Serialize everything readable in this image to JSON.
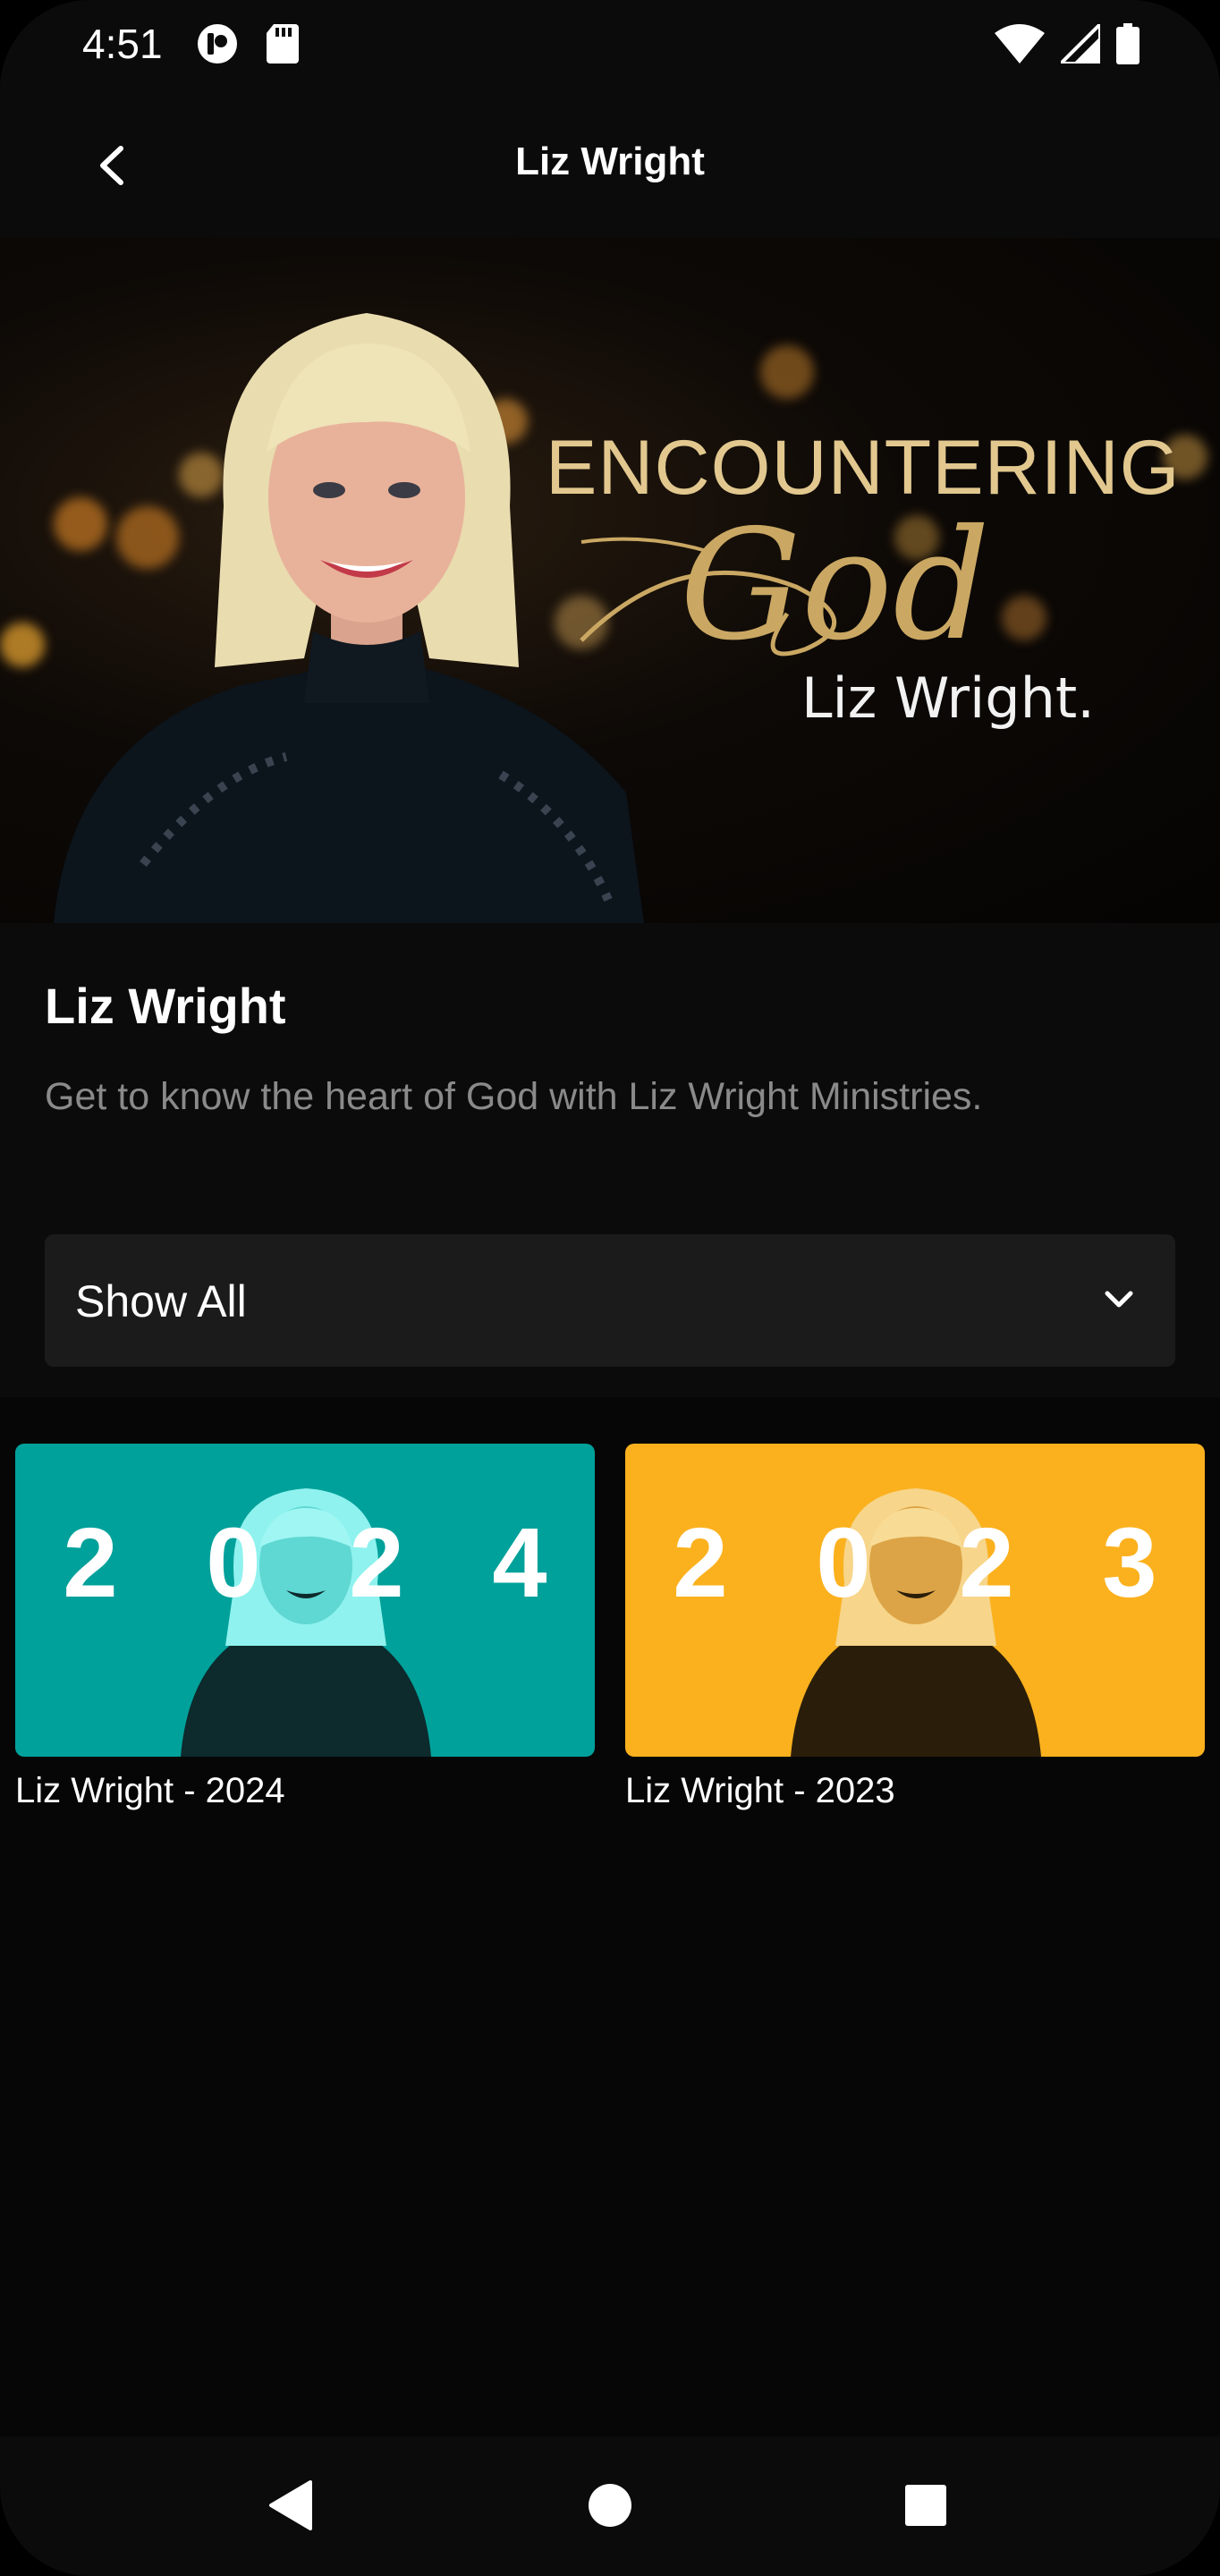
{
  "status_bar": {
    "time": "4:51",
    "left_icons": [
      "notification-app-icon",
      "sd-card-icon"
    ],
    "right_icons": [
      "wifi-icon",
      "signal-icon",
      "battery-icon"
    ]
  },
  "app_bar": {
    "title": "Liz Wright",
    "back_icon": "back-chevron-icon"
  },
  "hero": {
    "line1": "ENCOUNTERING",
    "line2": "God",
    "line3": "Liz Wright."
  },
  "info": {
    "title": "Liz Wright",
    "description": "Get to know the heart of God with Liz Wright Ministries."
  },
  "filter": {
    "selected": "Show All",
    "icon": "chevron-down-icon"
  },
  "cards": [
    {
      "label": "Liz Wright - 2024",
      "digits": [
        "2",
        "0",
        "2",
        "4"
      ],
      "color": "#00a19b"
    },
    {
      "label": "Liz Wright - 2023",
      "digits": [
        "2",
        "0",
        "2",
        "3"
      ],
      "color": "#fbb11e"
    }
  ],
  "nav": {
    "back": "triangle-back-icon",
    "home": "circle-home-icon",
    "recents": "square-recents-icon"
  },
  "colors": {
    "background": "#070707",
    "panel": "#0b0b0b",
    "dropdown": "#1b1b1b",
    "description": "#8a8a8a",
    "gold": "#caa863"
  }
}
